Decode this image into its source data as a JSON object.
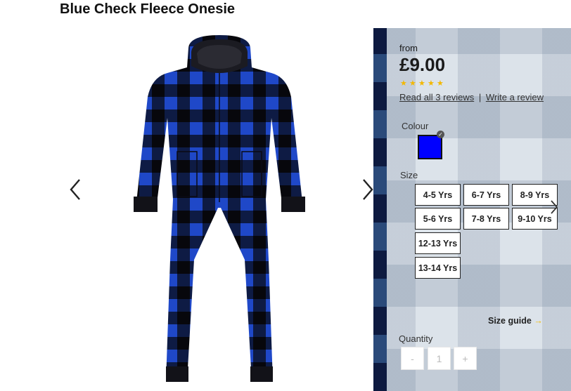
{
  "product": {
    "title": "Blue Check Fleece Onesie"
  },
  "gallery": {
    "prev_icon": "chevron-left-icon",
    "next_icon": "chevron-right-icon"
  },
  "pricing": {
    "from_label": "from",
    "price": "£9.00",
    "rating": 5,
    "star_color": "#f3b800"
  },
  "reviews": {
    "read_label": "Read all 3 reviews",
    "separator": "|",
    "write_label": "Write a review"
  },
  "colour": {
    "label": "Colour",
    "selected_hex": "#0000ff"
  },
  "size": {
    "label": "Size",
    "options": [
      "4-5 Yrs",
      "6-7 Yrs",
      "8-9 Yrs",
      "5-6 Yrs",
      "7-8 Yrs",
      "9-10 Yrs",
      "12-13 Yrs",
      "13-14 Yrs"
    ],
    "guide_label": "Size guide",
    "guide_arrow": "→"
  },
  "quantity": {
    "label": "Quantity",
    "decrement": "-",
    "value": "1",
    "increment": "+"
  },
  "colors": {
    "accent": "#f3b800",
    "text": "#1a1a1a"
  }
}
